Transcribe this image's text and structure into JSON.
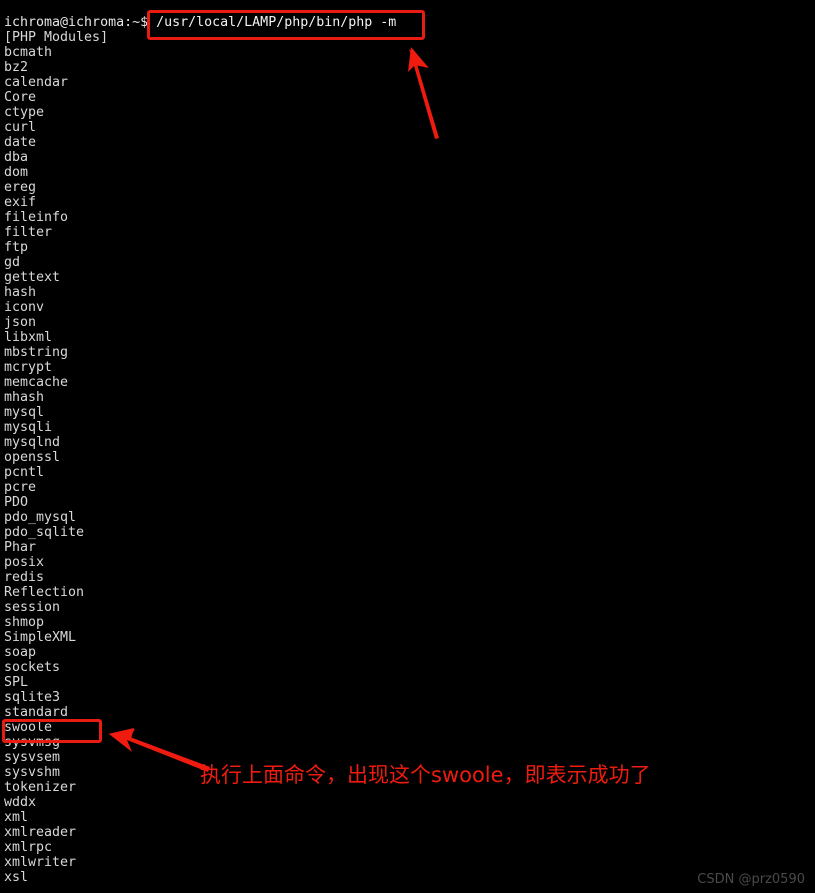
{
  "terminal": {
    "background_color": "#000000",
    "text_color": "#d8d8d8",
    "prompt": {
      "user_host": "ichroma@ichroma:~$",
      "command": " /usr/local/LAMP/php/bin/php -m"
    },
    "header": "[PHP Modules]",
    "modules": [
      "bcmath",
      "bz2",
      "calendar",
      "Core",
      "ctype",
      "curl",
      "date",
      "dba",
      "dom",
      "ereg",
      "exif",
      "fileinfo",
      "filter",
      "ftp",
      "gd",
      "gettext",
      "hash",
      "iconv",
      "json",
      "libxml",
      "mbstring",
      "mcrypt",
      "memcache",
      "mhash",
      "mysql",
      "mysqli",
      "mysqlnd",
      "openssl",
      "pcntl",
      "pcre",
      "PDO",
      "pdo_mysql",
      "pdo_sqlite",
      "Phar",
      "posix",
      "redis",
      "Reflection",
      "session",
      "shmop",
      "SimpleXML",
      "soap",
      "sockets",
      "SPL",
      "sqlite3",
      "standard",
      "swoole",
      "sysvmsg",
      "sysvsem",
      "sysvshm",
      "tokenizer",
      "wddx",
      "xml",
      "xmlreader",
      "xmlrpc",
      "xmlwriter",
      "xsl"
    ]
  },
  "annotations": {
    "accent_color": "#e81c12",
    "command_highlight_label": "/usr/local/LAMP/php/bin/php -m",
    "module_highlight_label": "swoole",
    "note_text": "执行上面命令，出现这个swoole，即表示成功了",
    "arrow_to_command": "arrow-up-left-icon",
    "arrow_to_swoole": "arrow-left-up-icon"
  },
  "watermark": {
    "text": "CSDN @prz0590"
  }
}
